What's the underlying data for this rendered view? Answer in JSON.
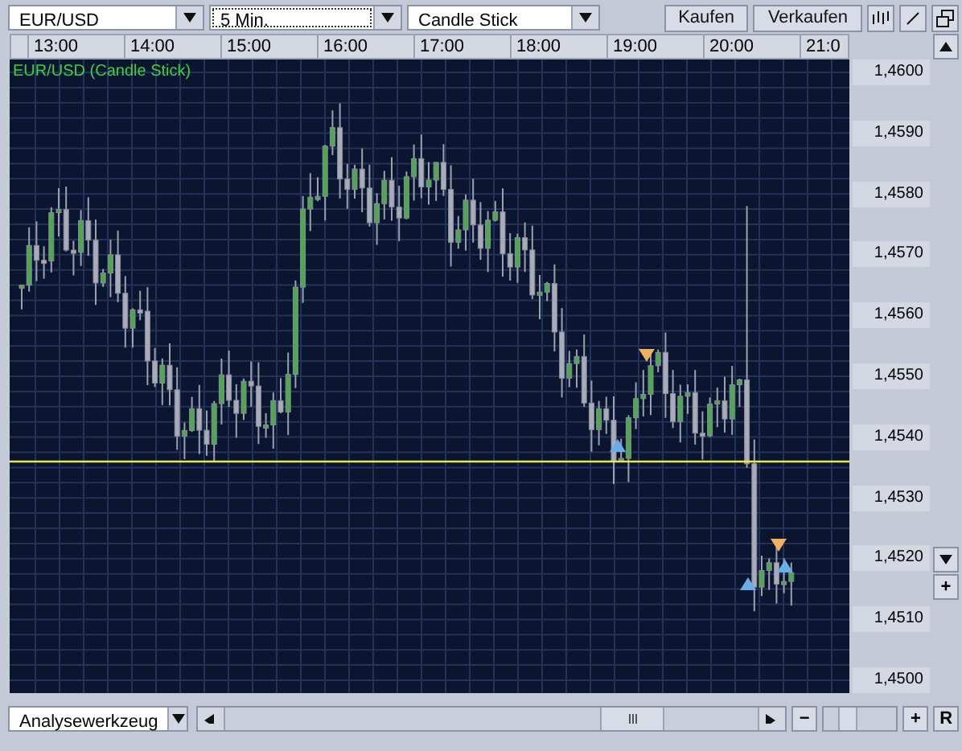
{
  "toolbar": {
    "selects": [
      {
        "value": "EUR/USD",
        "focused": false
      },
      {
        "value": "5 Min.",
        "focused": true
      },
      {
        "value": "Candle Stick",
        "focused": false
      }
    ],
    "buttons": [
      "Kaufen",
      "Verkaufen"
    ]
  },
  "time_axis": [
    "13:00",
    "14:00",
    "15:00",
    "16:00",
    "17:00",
    "18:00",
    "19:00",
    "20:00",
    "21:0"
  ],
  "chart": {
    "title": "EUR/USD (Candle Stick)"
  },
  "price_axis": [
    "1,4600",
    "1,4590",
    "1,4580",
    "1,4570",
    "1,4560",
    "1,4550",
    "1,4540",
    "1,4530",
    "1,4520",
    "1,4510",
    "1,4500"
  ],
  "side_buttons": [
    "+"
  ],
  "bottom_bar": {
    "tool_select": {
      "value": "Analysewerkzeug"
    },
    "zoom_out": "−",
    "zoom_in": "+",
    "reset": "R",
    "zoom_slider": {
      "level": 0.25
    }
  }
}
